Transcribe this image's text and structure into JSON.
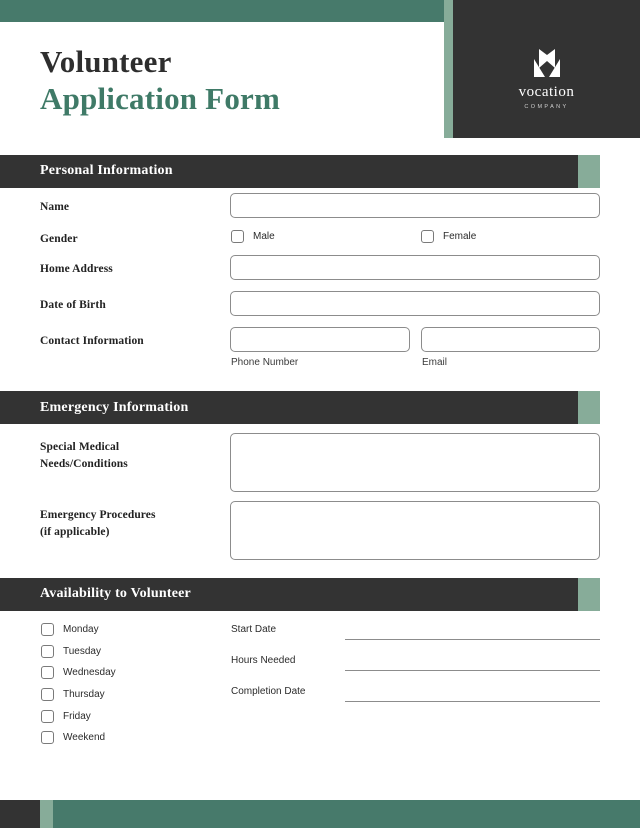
{
  "header": {
    "title_line_1": "Volunteer",
    "title_line_2": "Application Form",
    "brand_name": "vocation",
    "brand_sub": "COMPANY",
    "colors": {
      "dark_green": "#477a6b",
      "light_green": "#87ac99",
      "charcoal": "#333333",
      "title_accent": "#3f7a67"
    }
  },
  "sections": [
    {
      "id": "personal-information",
      "heading": "Personal Information",
      "fields": [
        {
          "label": "Name",
          "type": "text",
          "value": ""
        },
        {
          "label": "Gender",
          "type": "checkbox-group",
          "options": [
            {
              "label": "Male",
              "checked": false
            },
            {
              "label": "Female",
              "checked": false
            }
          ]
        },
        {
          "label": "Home Address",
          "type": "text",
          "value": ""
        },
        {
          "label": "Date of Birth",
          "type": "text",
          "value": ""
        },
        {
          "label": "Contact Information",
          "type": "split",
          "parts": [
            {
              "sub_label": "Phone Number",
              "value": ""
            },
            {
              "sub_label": "Email",
              "value": ""
            }
          ]
        }
      ]
    },
    {
      "id": "emergency-information",
      "heading": "Emergency Information",
      "fields": [
        {
          "label": "Special Medical\nNeeds/Conditions",
          "label_line_1": "Special Medical",
          "label_line_2": "Needs/Conditions",
          "type": "textarea",
          "value": ""
        },
        {
          "label": "Emergency Procedures\n(if applicable)",
          "label_line_1": "Emergency Procedures",
          "label_line_2": "(if applicable)",
          "type": "textarea",
          "value": ""
        }
      ]
    },
    {
      "id": "availability-to-volunteer",
      "heading": "Availability to Volunteer",
      "days": [
        {
          "label": "Monday",
          "checked": false
        },
        {
          "label": "Tuesday",
          "checked": false
        },
        {
          "label": "Wednesday",
          "checked": false
        },
        {
          "label": "Thursday",
          "checked": false
        },
        {
          "label": "Friday",
          "checked": false
        },
        {
          "label": "Weekend",
          "checked": false
        }
      ],
      "schedule": [
        {
          "label": "Start Date",
          "value": ""
        },
        {
          "label": "Hours Needed",
          "value": ""
        },
        {
          "label": "Completion Date",
          "value": ""
        }
      ]
    }
  ]
}
